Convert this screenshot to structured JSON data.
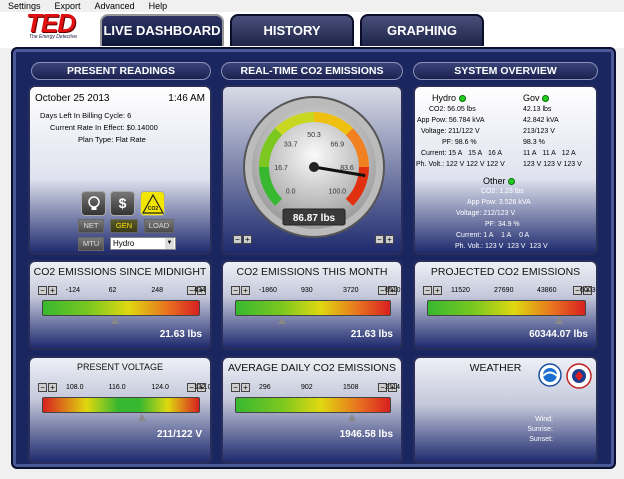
{
  "menu": [
    "Settings",
    "Export",
    "Advanced",
    "Help"
  ],
  "logo": {
    "main": "TED",
    "sub": "The Energy Detective"
  },
  "tabs": [
    {
      "label": "LIVE DASHBOARD",
      "active": true
    },
    {
      "label": "HISTORY",
      "active": false
    },
    {
      "label": "GRAPHING",
      "active": false
    }
  ],
  "headers": {
    "present": "PRESENT READINGS",
    "realtime": "REAL-TIME CO2 EMISSIONS",
    "system": "SYSTEM OVERVIEW"
  },
  "present": {
    "date": "October 25 2013",
    "time": "1:46 AM",
    "days_left": "Days Left In Billing Cycle: 6",
    "rate": "Current Rate In Effect: $0.14000",
    "plan": "Plan Type: Flat Rate",
    "icons": [
      "bulb-icon",
      "dollar-icon",
      "co2-icon"
    ],
    "co2_label": "CO2",
    "dollar": "$",
    "modes": [
      "NET",
      "GEN",
      "LOAD"
    ],
    "selected_mode": "GEN",
    "mtu": "MTU",
    "mtu_value": "Hydro"
  },
  "gauge": {
    "ticks": [
      "0.0",
      "16.7",
      "33.7",
      "50.3",
      "66.9",
      "83.6",
      "100.0"
    ],
    "value_text": "86.87 lbs",
    "value": 86.87
  },
  "system": {
    "hydro": {
      "name": "Hydro",
      "co2": "CO2: 56.05 lbs",
      "app": "App Pow: 56.784 kVA",
      "volt": "Voltage: 211/122 V",
      "pf": "PF: 98.6 %",
      "current_label": "Current:",
      "currents": [
        "15 A",
        "15 A",
        "16 A"
      ],
      "ph_label": "Ph. Volt.:",
      "ph": [
        "122 V",
        "122 V",
        "122 V"
      ]
    },
    "gov": {
      "name": "Gov",
      "co2": "42.13 lbs",
      "app": "42.842 kVA",
      "volt": "213/123 V",
      "pf": "98.3 %",
      "currents": [
        "11 A",
        "11 A",
        "12 A"
      ],
      "ph": [
        "123 V",
        "123 V",
        "123 V"
      ]
    },
    "other": {
      "name": "Other",
      "co2": "CO2: 1.23 lbs",
      "app": "App Pow: 3.526 kVA",
      "volt": "Voltage: 212/123 V",
      "pf": "PF: 34.9 %",
      "current_label": "Current:",
      "currents": [
        "1 A",
        "1 A",
        "0 A"
      ],
      "ph_label": "Ph. Volt.:",
      "ph": [
        "123 V",
        "123 V",
        "123 V"
      ]
    }
  },
  "boxes": {
    "midnight": {
      "title": "CO2 EMISSIONS SINCE MIDNIGHT",
      "ticks": [
        "-124",
        "62",
        "248",
        "434"
      ],
      "value": "21.63 lbs",
      "marker": 0.46
    },
    "month": {
      "title": "CO2 EMISSIONS THIS MONTH",
      "ticks": [
        "-1860",
        "930",
        "3720",
        "6510"
      ],
      "value": "21.63 lbs",
      "marker": 0.3
    },
    "projected": {
      "title": "PROJECTED CO2 EMISSIONS",
      "ticks": [
        "11520",
        "27690",
        "43860",
        "60030"
      ],
      "value": "60344.07 lbs",
      "marker": 0.83
    },
    "voltage": {
      "title": "PRESENT VOLTAGE",
      "ticks": [
        "108.0",
        "116.0",
        "124.0",
        "132.0"
      ],
      "value": "211/122 V",
      "marker": 0.63
    },
    "avgdaily": {
      "title": "AVERAGE DAILY CO2 EMISSIONS",
      "ticks": [
        "296",
        "902",
        "1508",
        "2114"
      ],
      "value": "1946.58 lbs",
      "marker": 0.75
    },
    "weather": {
      "title": "WEATHER",
      "wind": "Wind:",
      "sunrise": "Sunrise:",
      "sunset": "Sunset:"
    }
  },
  "controls": {
    "minus": "−",
    "plus": "+"
  },
  "colors": {
    "bar_green": "#38b830",
    "bar_yellow": "#e0d810",
    "bar_red": "#d82020",
    "panel_dark": "#1e2a6e"
  }
}
